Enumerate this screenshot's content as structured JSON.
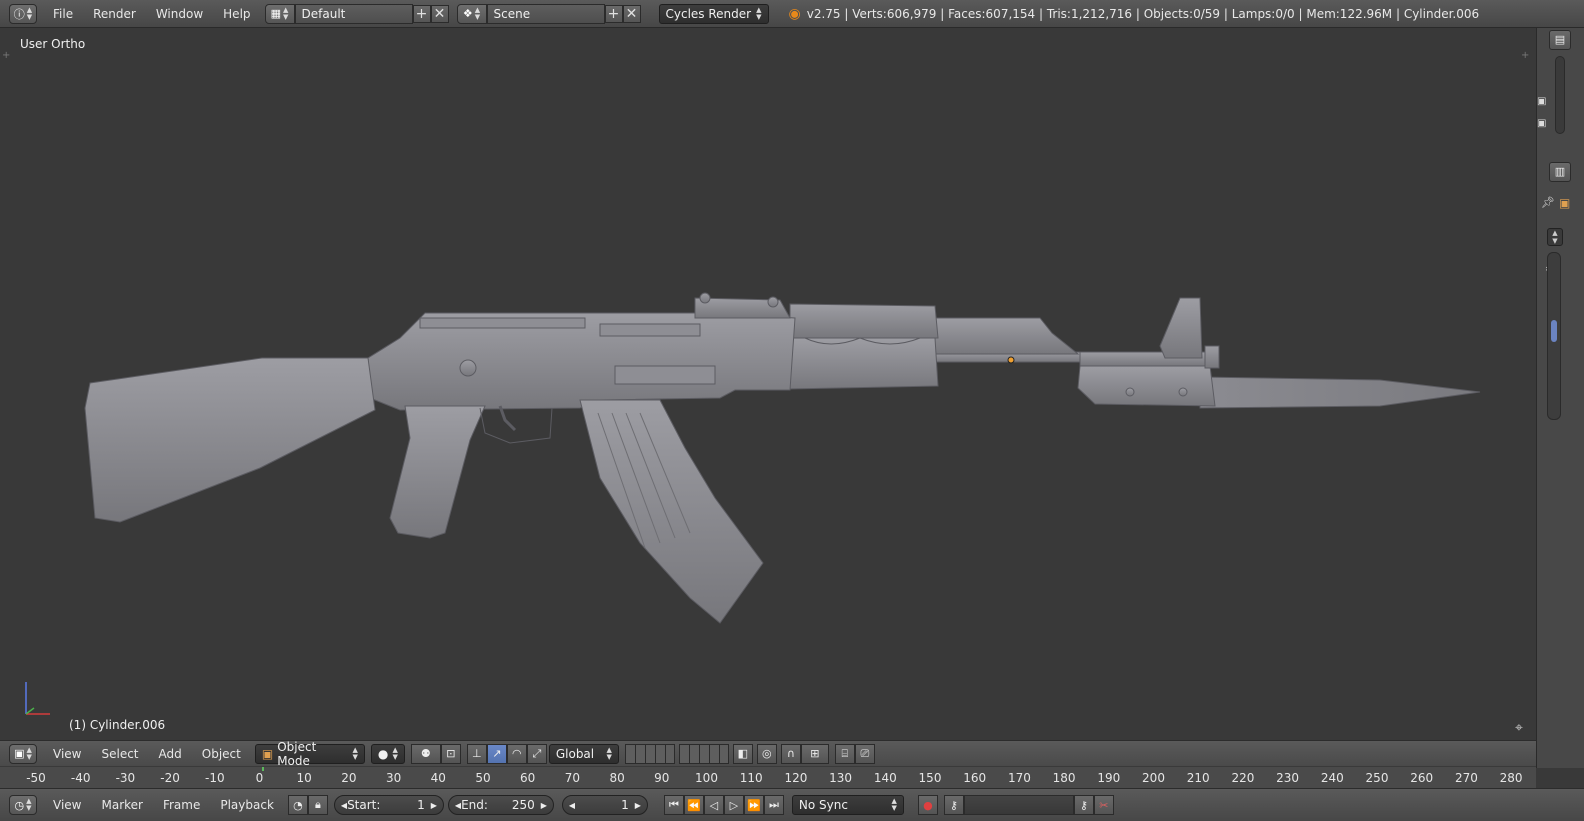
{
  "info_header": {
    "menus": [
      "File",
      "Render",
      "Window",
      "Help"
    ],
    "layout_name": "Default",
    "scene_name": "Scene",
    "render_engine": "Cycles Render",
    "stats": "v2.75 | Verts:606,979 | Faces:607,154 | Tris:1,212,716 | Objects:0/59 | Lamps:0/0 | Mem:122.96M | Cylinder.006"
  },
  "viewport": {
    "view_label": "User Ortho",
    "object_label": "(1) Cylinder.006",
    "model_color": "#8a8a8f",
    "background_color": "#393939"
  },
  "view3d_header": {
    "menus": [
      "View",
      "Select",
      "Add",
      "Object"
    ],
    "mode": "Object Mode",
    "orientation": "Global"
  },
  "timeline_ruler": {
    "ticks": [
      "-50",
      "-40",
      "-30",
      "-20",
      "-10",
      "0",
      "10",
      "20",
      "30",
      "40",
      "50",
      "60",
      "70",
      "80",
      "90",
      "100",
      "110",
      "120",
      "130",
      "140",
      "150",
      "160",
      "170",
      "180",
      "190",
      "200",
      "210",
      "220",
      "230",
      "240",
      "250",
      "260",
      "270",
      "280"
    ]
  },
  "timeline_header": {
    "menus": [
      "View",
      "Marker",
      "Frame",
      "Playback"
    ],
    "start_label": "Start:",
    "start_value": "1",
    "end_label": "End:",
    "end_value": "250",
    "current_frame": "1",
    "sync_mode": "No Sync"
  }
}
